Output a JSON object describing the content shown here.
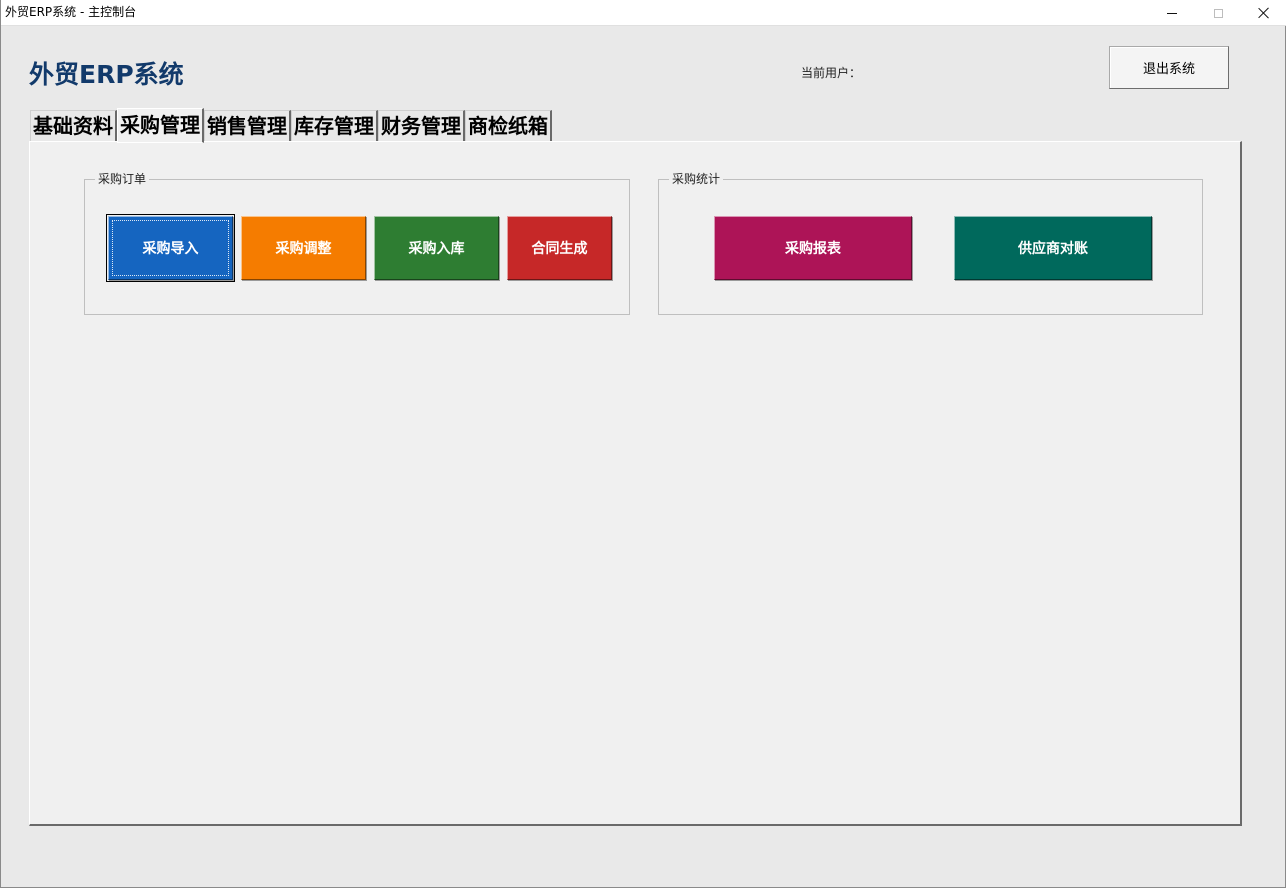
{
  "window": {
    "title": "外贸ERP系统 - 主控制台"
  },
  "header": {
    "app_title": "外贸ERP系统",
    "current_user_label": "当前用户：",
    "exit_label": "退出系统"
  },
  "tabs": [
    {
      "label": "基础资料",
      "active": false
    },
    {
      "label": "采购管理",
      "active": true
    },
    {
      "label": "销售管理",
      "active": false
    },
    {
      "label": "库存管理",
      "active": false
    },
    {
      "label": "财务管理",
      "active": false
    },
    {
      "label": "商检纸箱",
      "active": false
    }
  ],
  "groups": {
    "orders": {
      "title": "采购订单",
      "buttons": [
        {
          "label": "采购导入",
          "color": "#1565c0"
        },
        {
          "label": "采购调整",
          "color": "#f57c00"
        },
        {
          "label": "采购入库",
          "color": "#2e7d32"
        },
        {
          "label": "合同生成",
          "color": "#c62828"
        }
      ]
    },
    "stats": {
      "title": "采购统计",
      "buttons": [
        {
          "label": "采购报表",
          "color": "#ad1457"
        },
        {
          "label": "供应商对账",
          "color": "#00695c"
        }
      ]
    }
  }
}
